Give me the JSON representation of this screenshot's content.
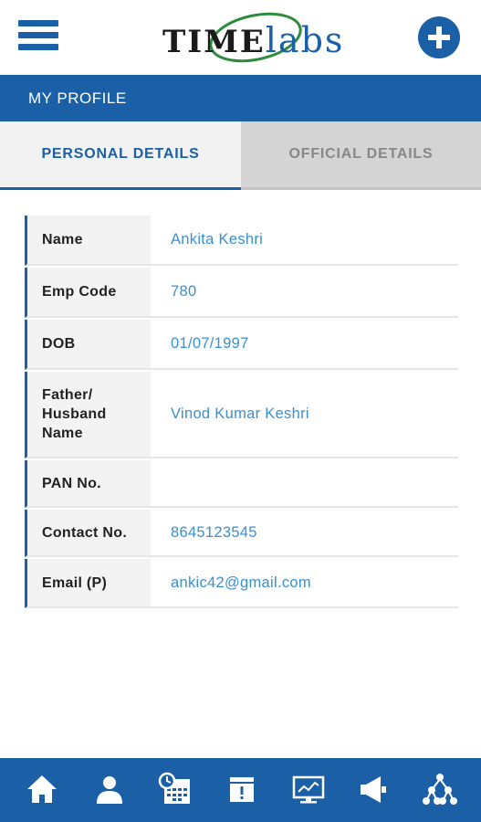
{
  "header": {
    "logo_time": "TIME",
    "logo_labs": "labs",
    "brand_color": "#1b5fa6"
  },
  "profile_bar": {
    "title": "MY PROFILE"
  },
  "tabs": [
    {
      "label": "PERSONAL DETAILS",
      "active": true
    },
    {
      "label": "OFFICIAL DETAILS",
      "active": false
    }
  ],
  "details": [
    {
      "label": "Name",
      "value": "Ankita Keshri"
    },
    {
      "label": "Emp Code",
      "value": "780"
    },
    {
      "label": "DOB",
      "value": "01/07/1997"
    },
    {
      "label": "Father/ Husband Name",
      "value": "Vinod Kumar Keshri"
    },
    {
      "label": "PAN No.",
      "value": ""
    },
    {
      "label": "Contact No.",
      "value": "8645123545"
    },
    {
      "label": "Email (P)",
      "value": "ankic42@gmail.com"
    }
  ],
  "bottom_nav": [
    {
      "icon": "home-icon"
    },
    {
      "icon": "user-icon"
    },
    {
      "icon": "attendance-calendar-icon"
    },
    {
      "icon": "alert-calendar-icon"
    },
    {
      "icon": "monitor-chart-icon"
    },
    {
      "icon": "megaphone-icon"
    },
    {
      "icon": "org-hierarchy-icon"
    }
  ]
}
